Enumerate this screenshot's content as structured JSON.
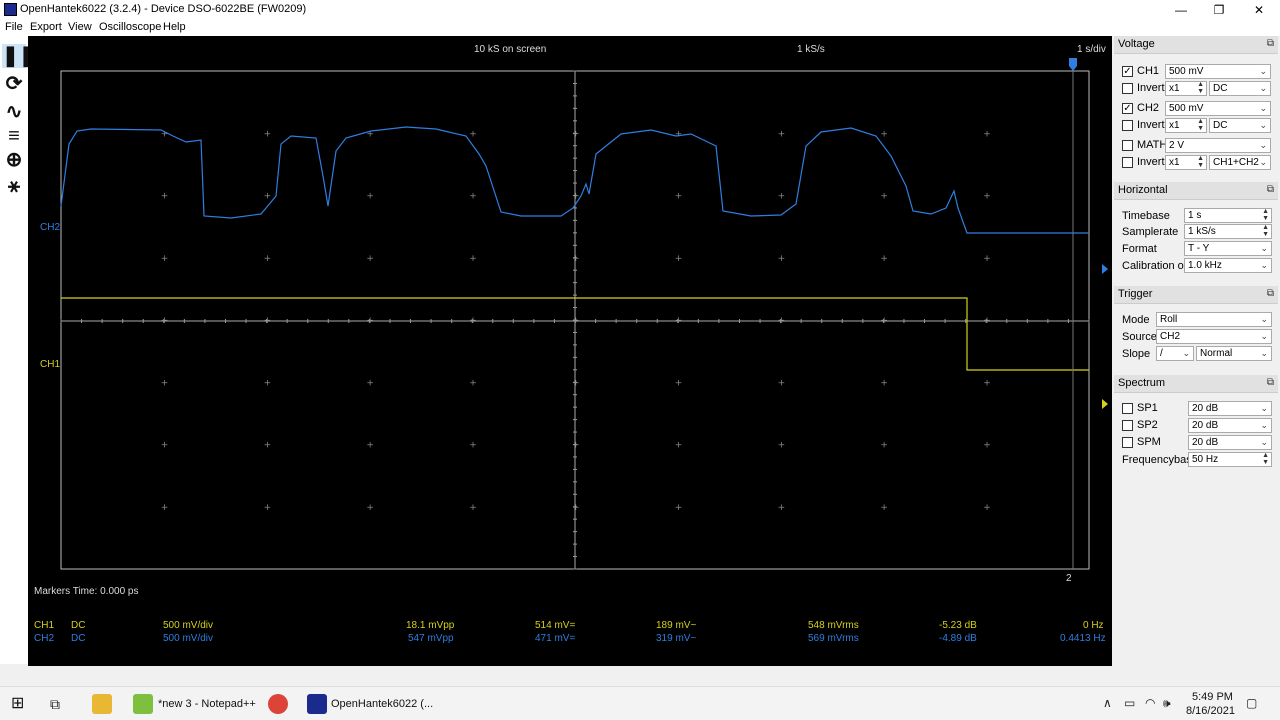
{
  "window": {
    "title": "OpenHantek6022 (3.2.4) - Device DSO-6022BE (FW0209)"
  },
  "menu": [
    "File",
    "Export",
    "View",
    "Oscilloscope",
    "Help"
  ],
  "toolbar_icons": [
    "pause-icon",
    "refresh-icon",
    "waveform-icon",
    "histogram-icon",
    "zoom-icon",
    "measure-icon"
  ],
  "scope": {
    "top_left": "10 kS on screen",
    "top_center": "1 kS/s",
    "top_right": "1 s/div",
    "ch2_marker": "CH2",
    "ch1_marker": "CH1",
    "cursor_label": "2",
    "markers_text": "Markers  Time: 0.000 ps",
    "colors": {
      "ch1": "#d4d21a",
      "ch2": "#2f7fe0",
      "grid": "#888888"
    }
  },
  "measurements": [
    {
      "ch": "CH1",
      "coupling": "DC",
      "vdiv": "500 mV/div",
      "vpp": "18.1 mVpp",
      "dc": "514 mV=",
      "ac": "189 mV~",
      "rms": "548 mVrms",
      "db": "-5.23 dB",
      "freq": "0 Hz"
    },
    {
      "ch": "CH2",
      "coupling": "DC",
      "vdiv": "500 mV/div",
      "vpp": "547 mVpp",
      "dc": "471 mV=",
      "ac": "319 mV~",
      "rms": "569 mVrms",
      "db": "-4.89 dB",
      "freq": "0.4413 Hz"
    }
  ],
  "voltage": {
    "title": "Voltage",
    "ch1": {
      "label": "CH1",
      "checked": true,
      "value": "500 mV"
    },
    "ch1_invert": {
      "label": "Invert",
      "probe": "x1",
      "coupling": "DC"
    },
    "ch2": {
      "label": "CH2",
      "checked": true,
      "value": "500 mV"
    },
    "ch2_invert": {
      "label": "Invert",
      "probe": "x1",
      "coupling": "DC"
    },
    "math": {
      "label": "MATH",
      "value": "2 V"
    },
    "math_invert": {
      "label": "Invert",
      "probe": "x1",
      "mode": "CH1+CH2"
    }
  },
  "horizontal": {
    "title": "Horizontal",
    "timebase_label": "Timebase",
    "timebase": "1 s",
    "samplerate_label": "Samplerate",
    "samplerate": "1 kS/s",
    "format_label": "Format",
    "format": "T - Y",
    "calibration_label": "Calibration out",
    "calibration": "1.0 kHz"
  },
  "trigger": {
    "title": "Trigger",
    "mode_label": "Mode",
    "mode": "Roll",
    "source_label": "Source",
    "source": "CH2",
    "slope_label": "Slope",
    "slope": "/",
    "slope_mode": "Normal"
  },
  "spectrum": {
    "title": "Spectrum",
    "sp1_label": "SP1",
    "sp1": "20 dB",
    "sp2_label": "SP2",
    "sp2": "20 dB",
    "spm_label": "SPM",
    "spm": "20 dB",
    "freqbase_label": "Frequencybase",
    "freqbase": "50 Hz"
  },
  "taskbar": {
    "notepad": "*new 3 - Notepad++",
    "hantek": "OpenHantek6022 (...",
    "time": "5:49 PM",
    "date": "8/16/2021"
  }
}
